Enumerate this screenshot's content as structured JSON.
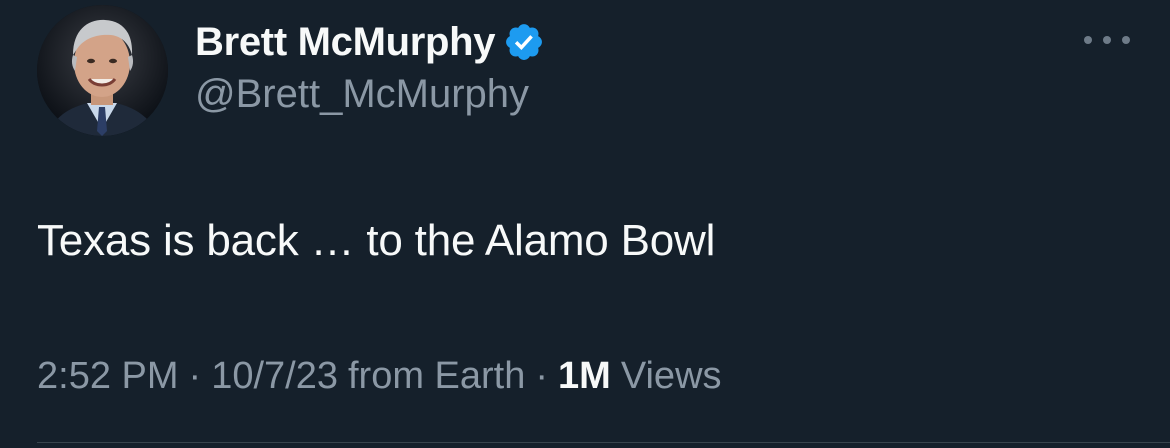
{
  "author": {
    "display_name": "Brett McMurphy",
    "handle": "@Brett_McMurphy",
    "verified": true,
    "verified_icon": "verified-badge-icon",
    "avatar_icon": "profile-photo"
  },
  "tweet": {
    "text": "Texas is back … to the Alamo Bowl"
  },
  "meta": {
    "time": "2:52 PM",
    "separator": "·",
    "date": "10/7/23",
    "source": "from Earth",
    "views_count": "1M",
    "views_label": "Views"
  },
  "more_menu": {
    "icon": "more-dots-icon"
  },
  "colors": {
    "background": "#15202b",
    "primary_text": "#f7f9f9",
    "secondary_text": "#8b98a5",
    "verified_blue": "#1d9bf0",
    "divider": "#38444d"
  }
}
